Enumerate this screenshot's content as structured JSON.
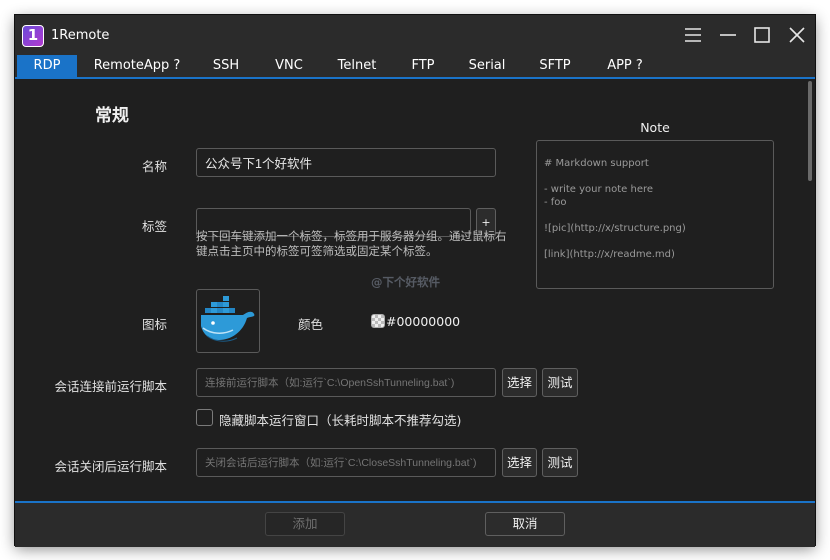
{
  "window": {
    "title": "1Remote",
    "logo_text": "1"
  },
  "tabs": [
    {
      "label": "RDP",
      "active": true
    },
    {
      "label": "RemoteApp ?"
    },
    {
      "label": "SSH"
    },
    {
      "label": "VNC"
    },
    {
      "label": "Telnet"
    },
    {
      "label": "FTP"
    },
    {
      "label": "Serial"
    },
    {
      "label": "SFTP"
    },
    {
      "label": "APP ?"
    }
  ],
  "section_title": "常规",
  "name": {
    "label": "名称",
    "value": "公众号下1个好软件"
  },
  "tag": {
    "label": "标签",
    "value": "",
    "add_label": "+",
    "hint": "按下回车键添加一个标签，标签用于服务器分组。通过鼠标右键点击主页中的标签可签筛选或固定某个标签。"
  },
  "icon": {
    "label": "图标",
    "image": "docker-whale-icon"
  },
  "color": {
    "label": "颜色",
    "value": "#00000000"
  },
  "pre_script": {
    "label": "会话连接前运行脚本",
    "placeholder": "连接前运行脚本（如:运行`C:\\OpenSshTunneling.bat`)",
    "select_label": "选择",
    "test_label": "测试"
  },
  "hide_script": {
    "label": "隐藏脚本运行窗口（长耗时脚本不推荐勾选)",
    "checked": false
  },
  "post_script": {
    "label": "会话关闭后运行脚本",
    "placeholder": "关闭会话后运行脚本（如:运行`C:\\CloseSshTunneling.bat`)",
    "select_label": "选择",
    "test_label": "测试"
  },
  "note": {
    "title": "Note",
    "content": "# Markdown support\n\n- write your note here\n- foo\n\n![pic](http://x/structure.png)\n\n[link](http://x/readme.md)"
  },
  "watermark": "@下个好软件",
  "footer": {
    "add_label": "添加",
    "cancel_label": "取消"
  },
  "colors": {
    "accent": "#1a73c8",
    "background": "#1f1f1f",
    "titlebar": "#2b2b2b",
    "docker_blue": "#2d9ad8"
  }
}
